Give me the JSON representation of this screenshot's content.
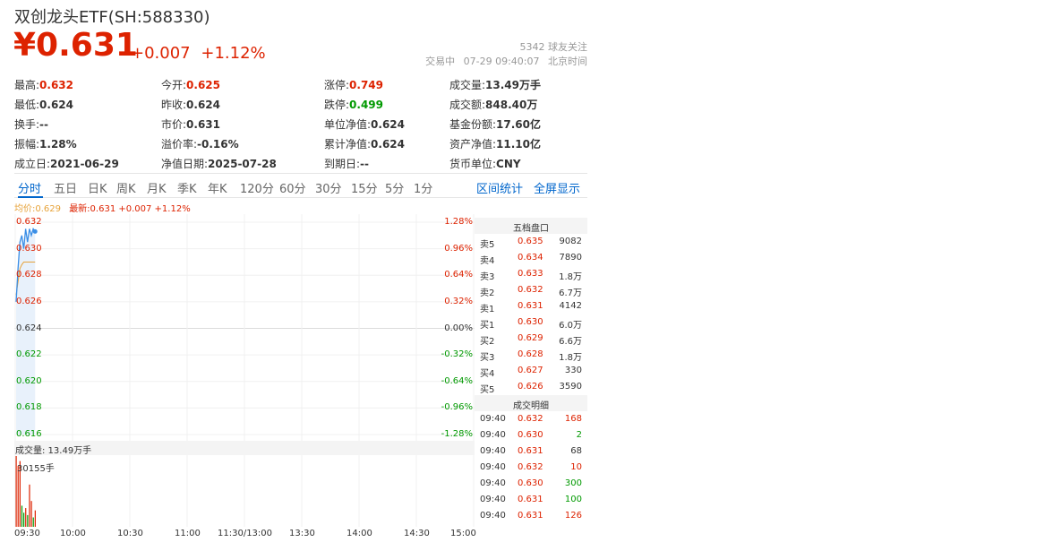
{
  "header": {
    "title": "双创龙头ETF(SH:588330)",
    "price": "¥0.631",
    "change": "+0.007",
    "change_pct": "+1.12%",
    "followers": "5342  球友关注",
    "status": "交易中",
    "time": "07-29  09:40:07",
    "timezone": "北京时间"
  },
  "quote": [
    [
      {
        "label": "最高:",
        "value": "0.632",
        "color": "red"
      },
      {
        "label": "今开:",
        "value": "0.625",
        "color": "red"
      },
      {
        "label": "涨停:",
        "value": "0.749",
        "color": "red"
      },
      {
        "label": "成交量:",
        "value": "13.49万手",
        "color": ""
      }
    ],
    [
      {
        "label": "最低:",
        "value": "0.624",
        "color": ""
      },
      {
        "label": "昨收:",
        "value": "0.624",
        "color": ""
      },
      {
        "label": "跌停:",
        "value": "0.499",
        "color": "green"
      },
      {
        "label": "成交额:",
        "value": "848.40万",
        "color": ""
      }
    ],
    [
      {
        "label": "换手:",
        "value": "--",
        "color": ""
      },
      {
        "label": "市价:",
        "value": "0.631",
        "color": ""
      },
      {
        "label": "单位净值:",
        "value": "0.624",
        "color": ""
      },
      {
        "label": "基金份额:",
        "value": "17.60亿",
        "color": ""
      }
    ],
    [
      {
        "label": "振幅:",
        "value": "1.28%",
        "color": ""
      },
      {
        "label": "溢价率:",
        "value": "-0.16%",
        "color": ""
      },
      {
        "label": "累计净值:",
        "value": "0.624",
        "color": ""
      },
      {
        "label": "资产净值:",
        "value": "11.10亿",
        "color": ""
      }
    ],
    [
      {
        "label": "成立日:",
        "value": "2021-06-29",
        "color": ""
      },
      {
        "label": "净值日期:",
        "value": "2025-07-28",
        "color": ""
      },
      {
        "label": "到期日:",
        "value": "--",
        "color": ""
      },
      {
        "label": "货币单位:",
        "value": "CNY",
        "color": ""
      }
    ]
  ],
  "tabs": [
    "分时",
    "五日",
    "日K",
    "周K",
    "月K",
    "季K",
    "年K",
    "120分",
    "60分",
    "30分",
    "15分",
    "5分",
    "1分"
  ],
  "tab_actions": [
    "区间统计",
    "全屏显示"
  ],
  "legend": {
    "avg": "均价:0.629",
    "latest": "最新:0.631 +0.007 +1.12%"
  },
  "volume": {
    "label": "成交量: 13.49万手",
    "max": "30155手"
  },
  "orderbook": {
    "title": "五档盘口",
    "rows": [
      {
        "side": "卖5",
        "price": "0.635",
        "vol": "9082"
      },
      {
        "side": "卖4",
        "price": "0.634",
        "vol": "7890"
      },
      {
        "side": "卖3",
        "price": "0.633",
        "vol": "1.8万"
      },
      {
        "side": "卖2",
        "price": "0.632",
        "vol": "6.7万"
      },
      {
        "side": "卖1",
        "price": "0.631",
        "vol": "4142"
      },
      {
        "side": "买1",
        "price": "0.630",
        "vol": "6.0万"
      },
      {
        "side": "买2",
        "price": "0.629",
        "vol": "6.6万"
      },
      {
        "side": "买3",
        "price": "0.628",
        "vol": "1.8万"
      },
      {
        "side": "买4",
        "price": "0.627",
        "vol": "330"
      },
      {
        "side": "买5",
        "price": "0.626",
        "vol": "3590"
      }
    ],
    "trades_title": "成交明细",
    "trades": [
      {
        "time": "09:40",
        "price": "0.632",
        "vol": "168",
        "dir": "red"
      },
      {
        "time": "09:40",
        "price": "0.630",
        "vol": "2",
        "dir": "green"
      },
      {
        "time": "09:40",
        "price": "0.631",
        "vol": "68",
        "dir": ""
      },
      {
        "time": "09:40",
        "price": "0.632",
        "vol": "10",
        "dir": "red"
      },
      {
        "time": "09:40",
        "price": "0.630",
        "vol": "300",
        "dir": "green"
      },
      {
        "time": "09:40",
        "price": "0.631",
        "vol": "100",
        "dir": "green"
      },
      {
        "time": "09:40",
        "price": "0.631",
        "vol": "126",
        "dir": "red"
      }
    ]
  },
  "colors": {
    "up": "#dd2200",
    "down": "#009900",
    "link": "#0066cc",
    "avg_line": "#e7a33a",
    "price_line": "#3a8ee6"
  },
  "chart_data": {
    "type": "line",
    "y_ticks": [
      "0.632",
      "0.630",
      "0.628",
      "0.626",
      "0.624",
      "0.622",
      "0.620",
      "0.618",
      "0.616"
    ],
    "y_pct": [
      "1.28%",
      "0.96%",
      "0.64%",
      "0.32%",
      "0.00%",
      "-0.32%",
      "-0.64%",
      "-0.96%",
      "-1.28%"
    ],
    "x_ticks": [
      "09:30",
      "10:00",
      "10:30",
      "11:00",
      "11:30/13:00",
      "13:30",
      "14:00",
      "14:30",
      "15:00"
    ],
    "ylim": [
      0.616,
      0.632
    ],
    "prev_close": 0.624,
    "minutes_total": 240,
    "price": [
      0.626,
      0.6285,
      0.6305,
      0.631,
      0.63,
      0.6315,
      0.6305,
      0.6315,
      0.631,
      0.6315,
      0.6313
    ],
    "avg": [
      0.6265,
      0.6275,
      0.6285,
      0.6288,
      0.629,
      0.629,
      0.629,
      0.629,
      0.629,
      0.629,
      0.629
    ],
    "volume_max": 30155,
    "volume": [
      30155,
      26000,
      28000,
      9000,
      6000,
      8000,
      5000,
      18000,
      11000,
      4000,
      7000
    ],
    "volume_dir": [
      "red",
      "red",
      "red",
      "green",
      "green",
      "red",
      "green",
      "red",
      "red",
      "green",
      "red"
    ]
  }
}
